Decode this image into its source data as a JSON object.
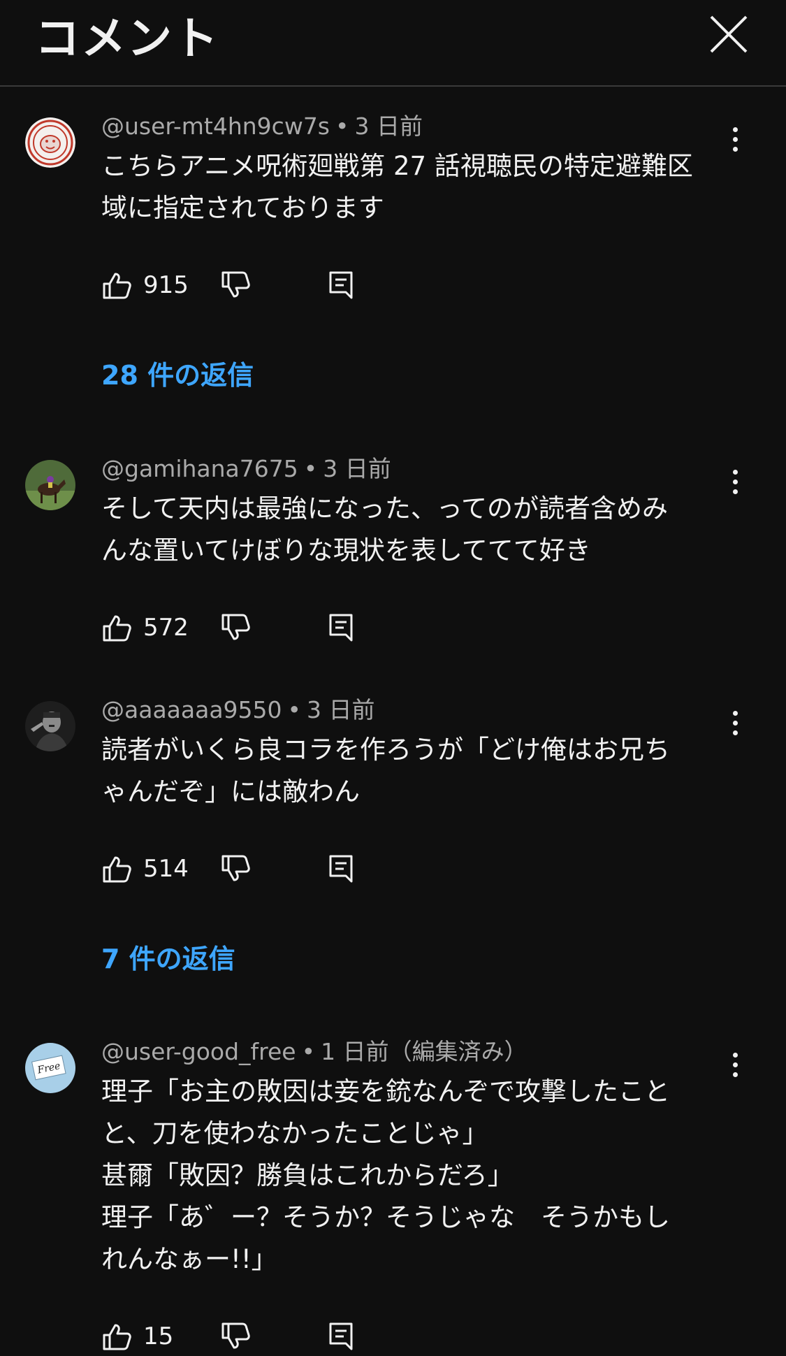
{
  "header": {
    "title": "コメント"
  },
  "comments": [
    {
      "author": "@user-mt4hn9cw7s",
      "time": "3 日前",
      "text": "こちらアニメ呪術廻戦第 27 話視聴民の特定避難区\n域に指定されております",
      "likes": "915",
      "replies_label": "28 件の返信"
    },
    {
      "author": "@gamihana7675",
      "time": "3 日前",
      "text": "そして天内は最強になった、ってのが読者含めみ\nんな置いてけぼりな現状を表しててて好き",
      "likes": "572"
    },
    {
      "author": "@aaaaaaa9550",
      "time": "3 日前",
      "text": "読者がいくら良コラを作ろうが「どけ俺はお兄ち\nゃんだぞ」には敵わん",
      "likes": "514",
      "replies_label": "7 件の返信"
    },
    {
      "author": "@user-good_free",
      "time": "1 日前（編集済み）",
      "text": "理子「お主の敗因は妾を銃なんぞで攻撃したこと\nと、刀を使わなかったことじゃ」\n甚爾「敗因？勝負はこれからだろ」\n理子「あ゛ー？そうか？そうじゃな　そうかもし\nれんなぁー!!」",
      "likes": "15",
      "avatar_text": "Free"
    }
  ],
  "colors": {
    "background": "#0f0f0f",
    "link": "#3ea6ff",
    "meta": "#aaaaaa"
  }
}
